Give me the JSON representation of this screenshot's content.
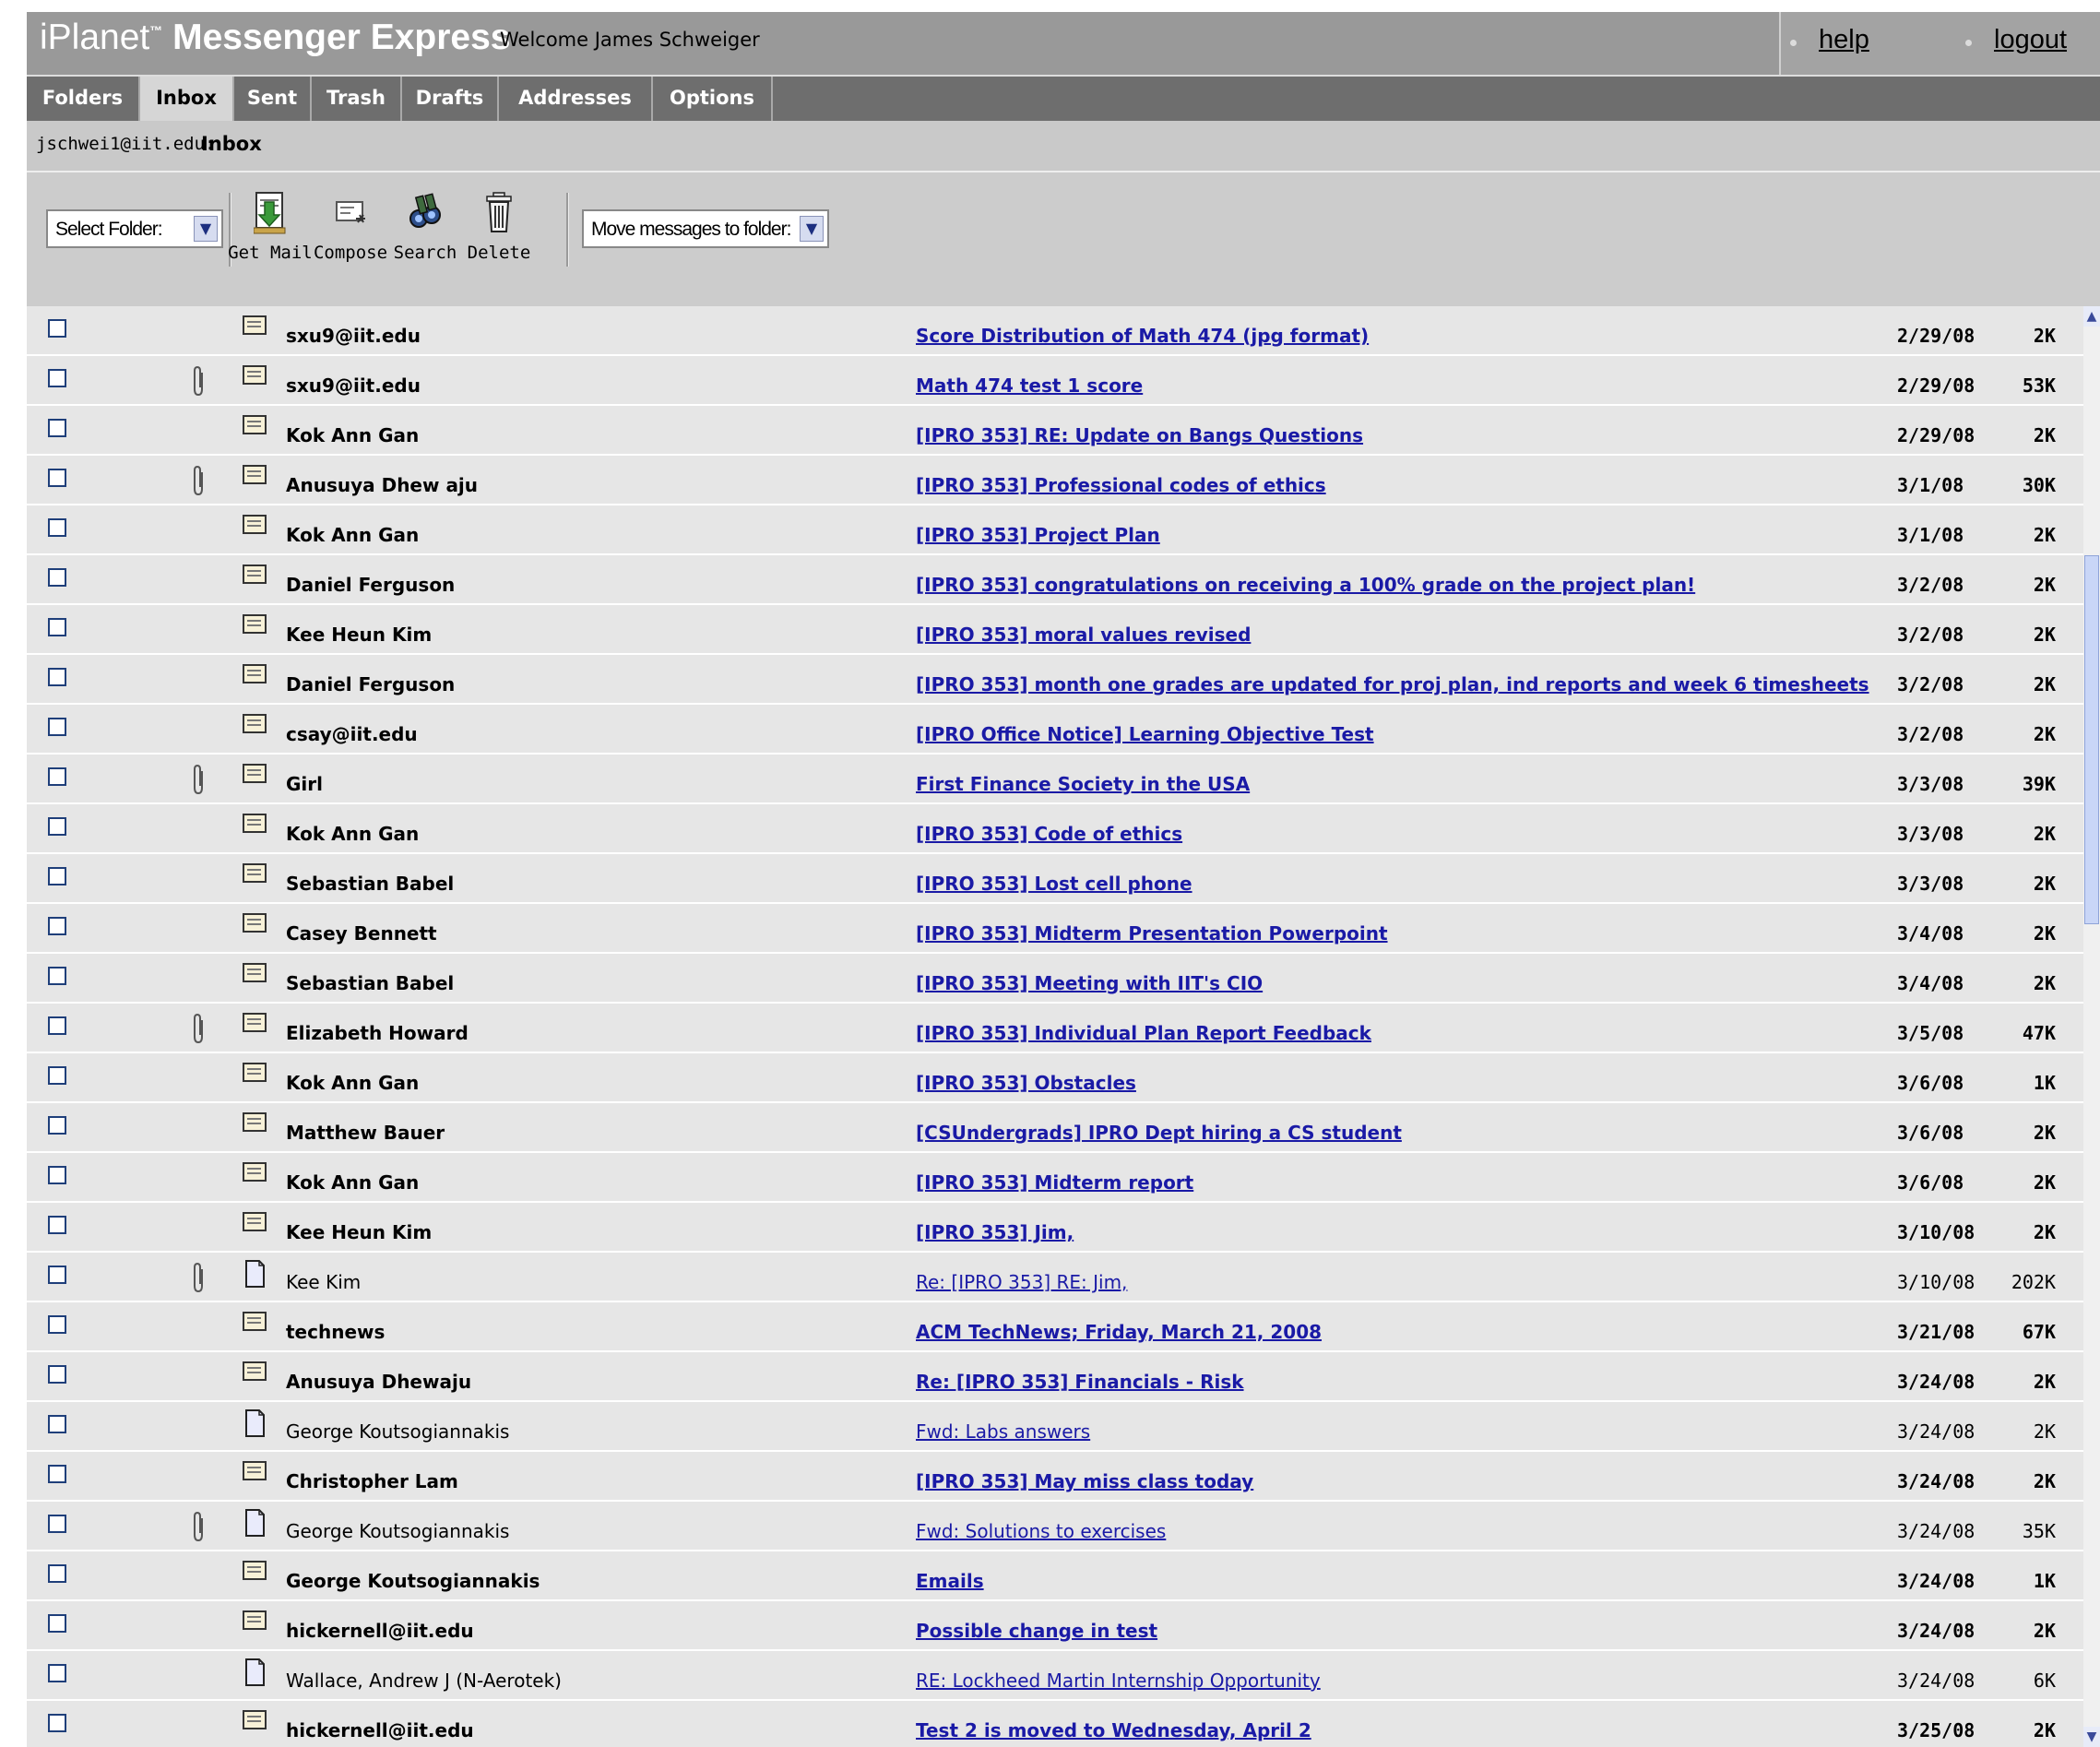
{
  "header": {
    "brand_part1": "iPlanet",
    "brand_tm": "™",
    "brand_part2": "Messenger Express",
    "welcome": "Welcome James Schweiger",
    "help": "help",
    "logout": "logout"
  },
  "tabs": [
    {
      "label": "Folders",
      "active": false
    },
    {
      "label": "Inbox",
      "active": true
    },
    {
      "label": "Sent",
      "active": false
    },
    {
      "label": "Trash",
      "active": false
    },
    {
      "label": "Drafts",
      "active": false
    },
    {
      "label": "Addresses",
      "active": false
    },
    {
      "label": "Options",
      "active": false
    }
  ],
  "breadcrumb": {
    "user": "jschwei1@iit.edu:",
    "folder": "Inbox"
  },
  "toolbar": {
    "select_folder": "Select Folder:",
    "get_mail": "Get Mail",
    "compose": "Compose",
    "search": "Search",
    "delete": "Delete",
    "move_to": "Move messages to folder:"
  },
  "colors": {
    "link": "#1a1aa6",
    "header_bg": "#999999",
    "tabs_bg": "#6e6e6e",
    "list_bg": "#e6e6e6"
  },
  "messages": [
    {
      "from": "sxu9@iit.edu",
      "subject": "Score Distribution of Math 474 (jpg format)",
      "date": "2/29/08",
      "size": "2K",
      "attachment": false,
      "unread": true
    },
    {
      "from": "sxu9@iit.edu",
      "subject": "Math 474 test 1 score",
      "date": "2/29/08",
      "size": "53K",
      "attachment": true,
      "unread": true
    },
    {
      "from": "Kok Ann Gan",
      "subject": "[IPRO 353] RE: Update on Bangs Questions",
      "date": "2/29/08",
      "size": "2K",
      "attachment": false,
      "unread": true
    },
    {
      "from": "Anusuya Dhew aju",
      "subject": "[IPRO 353] Professional codes of ethics",
      "date": "3/1/08",
      "size": "30K",
      "attachment": true,
      "unread": true
    },
    {
      "from": "Kok Ann Gan",
      "subject": "[IPRO 353] Project Plan",
      "date": "3/1/08",
      "size": "2K",
      "attachment": false,
      "unread": true
    },
    {
      "from": "Daniel Ferguson",
      "subject": "[IPRO 353] congratulations on receiving a 100% grade on the project plan!",
      "date": "3/2/08",
      "size": "2K",
      "attachment": false,
      "unread": true
    },
    {
      "from": "Kee Heun Kim",
      "subject": "[IPRO 353] moral values revised",
      "date": "3/2/08",
      "size": "2K",
      "attachment": false,
      "unread": true
    },
    {
      "from": "Daniel Ferguson",
      "subject": "[IPRO 353] month one grades are updated for proj plan, ind reports and week 6 timesheets",
      "date": "3/2/08",
      "size": "2K",
      "attachment": false,
      "unread": true
    },
    {
      "from": "csay@iit.edu",
      "subject": "[IPRO Office Notice] Learning Objective Test",
      "date": "3/2/08",
      "size": "2K",
      "attachment": false,
      "unread": true
    },
    {
      "from": "Girl",
      "subject": "First Finance Society in the USA",
      "date": "3/3/08",
      "size": "39K",
      "attachment": true,
      "unread": true
    },
    {
      "from": "Kok Ann Gan",
      "subject": "[IPRO 353] Code of ethics",
      "date": "3/3/08",
      "size": "2K",
      "attachment": false,
      "unread": true
    },
    {
      "from": "Sebastian Babel",
      "subject": "[IPRO 353] Lost cell phone",
      "date": "3/3/08",
      "size": "2K",
      "attachment": false,
      "unread": true
    },
    {
      "from": "Casey Bennett",
      "subject": "[IPRO 353] Midterm Presentation Powerpoint",
      "date": "3/4/08",
      "size": "2K",
      "attachment": false,
      "unread": true
    },
    {
      "from": "Sebastian Babel",
      "subject": "[IPRO 353] Meeting with IIT's CIO",
      "date": "3/4/08",
      "size": "2K",
      "attachment": false,
      "unread": true
    },
    {
      "from": "Elizabeth Howard",
      "subject": "[IPRO 353] Individual Plan Report Feedback",
      "date": "3/5/08",
      "size": "47K",
      "attachment": true,
      "unread": true
    },
    {
      "from": "Kok Ann Gan",
      "subject": "[IPRO 353] Obstacles",
      "date": "3/6/08",
      "size": "1K",
      "attachment": false,
      "unread": true
    },
    {
      "from": "Matthew Bauer",
      "subject": "[CSUndergrads] IPRO Dept hiring a CS student",
      "date": "3/6/08",
      "size": "2K",
      "attachment": false,
      "unread": true
    },
    {
      "from": "Kok Ann Gan",
      "subject": "[IPRO 353] Midterm report",
      "date": "3/6/08",
      "size": "2K",
      "attachment": false,
      "unread": true
    },
    {
      "from": "Kee Heun Kim",
      "subject": "[IPRO 353] Jim,",
      "date": "3/10/08",
      "size": "2K",
      "attachment": false,
      "unread": true
    },
    {
      "from": "Kee Kim",
      "subject": "Re: [IPRO 353] RE: Jim,",
      "date": "3/10/08",
      "size": "202K",
      "attachment": true,
      "unread": false
    },
    {
      "from": "technews",
      "subject": "ACM TechNews; Friday, March 21, 2008",
      "date": "3/21/08",
      "size": "67K",
      "attachment": false,
      "unread": true
    },
    {
      "from": "Anusuya Dhewaju",
      "subject": "Re: [IPRO 353] Financials - Risk",
      "date": "3/24/08",
      "size": "2K",
      "attachment": false,
      "unread": true
    },
    {
      "from": "George Koutsogiannakis",
      "subject": "Fwd: Labs answers",
      "date": "3/24/08",
      "size": "2K",
      "attachment": false,
      "unread": false
    },
    {
      "from": "Christopher Lam",
      "subject": "[IPRO 353] May miss class today",
      "date": "3/24/08",
      "size": "2K",
      "attachment": false,
      "unread": true
    },
    {
      "from": "George Koutsogiannakis",
      "subject": "Fwd: Solutions to exercises",
      "date": "3/24/08",
      "size": "35K",
      "attachment": true,
      "unread": false
    },
    {
      "from": "George Koutsogiannakis",
      "subject": "Emails",
      "date": "3/24/08",
      "size": "1K",
      "attachment": false,
      "unread": true
    },
    {
      "from": "hickernell@iit.edu",
      "subject": "Possible change in test",
      "date": "3/24/08",
      "size": "2K",
      "attachment": false,
      "unread": true
    },
    {
      "from": "Wallace, Andrew J (N-Aerotek)",
      "subject": "RE: Lockheed Martin Internship Opportunity",
      "date": "3/24/08",
      "size": "6K",
      "attachment": false,
      "unread": false
    },
    {
      "from": "hickernell@iit.edu",
      "subject": "Test 2 is moved to Wednesday, April 2",
      "date": "3/25/08",
      "size": "2K",
      "attachment": false,
      "unread": true
    }
  ]
}
